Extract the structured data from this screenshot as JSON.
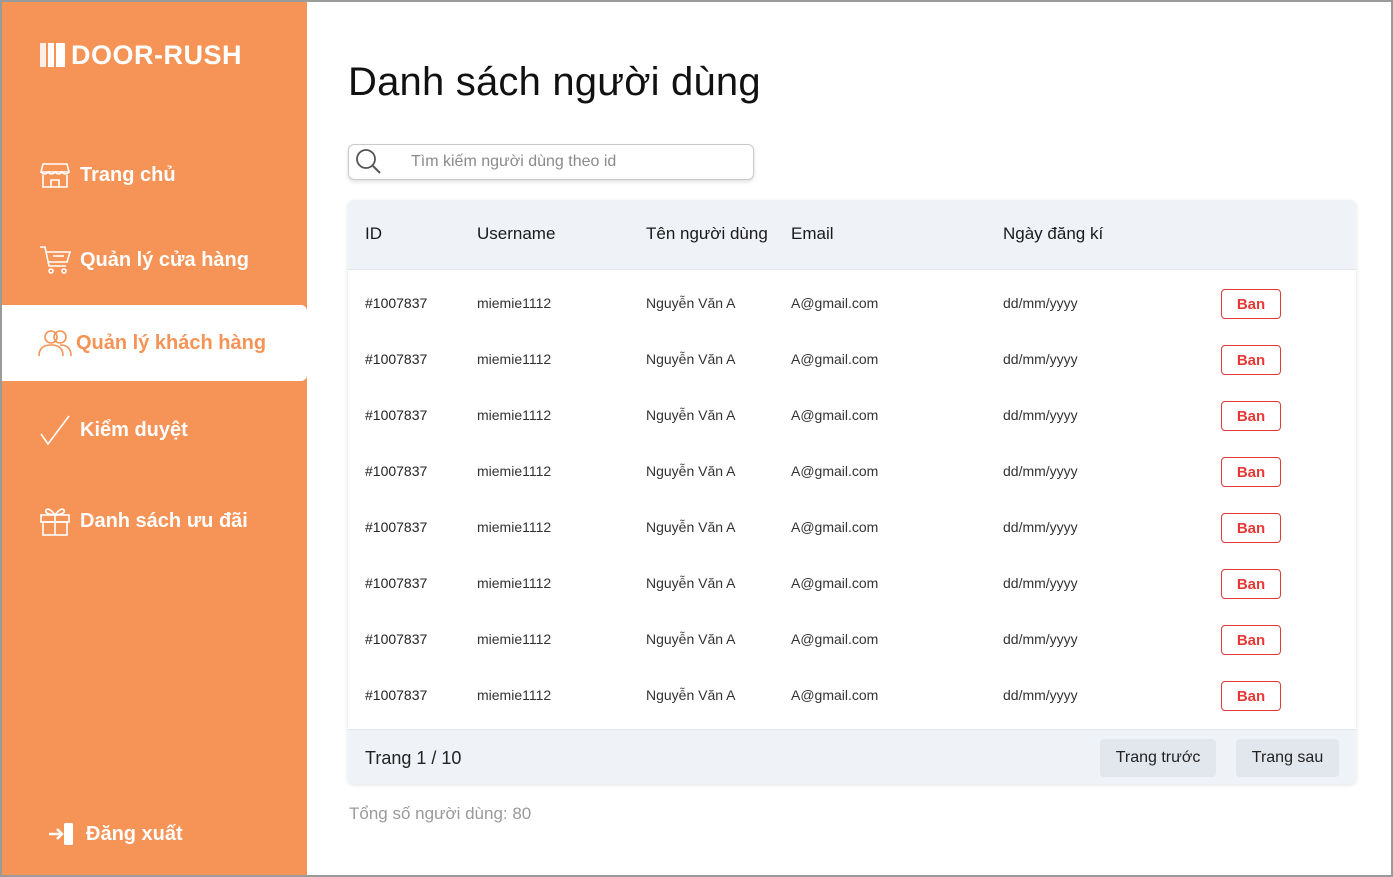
{
  "app": {
    "brand": "DOOR-RUSH"
  },
  "sidebar": {
    "items": [
      {
        "label": "Trang chủ",
        "icon": "store-icon",
        "active": false
      },
      {
        "label": "Quản lý cửa hàng",
        "icon": "cart-icon",
        "active": false
      },
      {
        "label": "Quản lý khách hàng",
        "icon": "users-icon",
        "active": true
      },
      {
        "label": "Kiểm duyệt",
        "icon": "check-icon",
        "active": false
      },
      {
        "label": "Danh sách ưu đãi",
        "icon": "gift-icon",
        "active": false
      }
    ],
    "logout_label": "Đăng xuất",
    "logout_icon": "logout-icon"
  },
  "main": {
    "title": "Danh sách người dùng",
    "search": {
      "placeholder": "Tìm kiếm người dùng theo id",
      "value": "",
      "icon": "search-icon"
    },
    "table": {
      "columns": [
        "ID",
        "Username",
        "Tên người dùng",
        "Email",
        "Ngày đăng kí"
      ],
      "action_label": "Ban",
      "rows": [
        {
          "id": "#1007837",
          "username": "miemie1112",
          "name": "Nguyễn Văn A",
          "email": "A@gmail.com",
          "date": "dd/mm/yyyy"
        },
        {
          "id": "#1007837",
          "username": "miemie1112",
          "name": "Nguyễn Văn A",
          "email": "A@gmail.com",
          "date": "dd/mm/yyyy"
        },
        {
          "id": "#1007837",
          "username": "miemie1112",
          "name": "Nguyễn Văn A",
          "email": "A@gmail.com",
          "date": "dd/mm/yyyy"
        },
        {
          "id": "#1007837",
          "username": "miemie1112",
          "name": "Nguyễn Văn A",
          "email": "A@gmail.com",
          "date": "dd/mm/yyyy"
        },
        {
          "id": "#1007837",
          "username": "miemie1112",
          "name": "Nguyễn Văn A",
          "email": "A@gmail.com",
          "date": "dd/mm/yyyy"
        },
        {
          "id": "#1007837",
          "username": "miemie1112",
          "name": "Nguyễn Văn A",
          "email": "A@gmail.com",
          "date": "dd/mm/yyyy"
        },
        {
          "id": "#1007837",
          "username": "miemie1112",
          "name": "Nguyễn Văn A",
          "email": "A@gmail.com",
          "date": "dd/mm/yyyy"
        },
        {
          "id": "#1007837",
          "username": "miemie1112",
          "name": "Nguyễn Văn A",
          "email": "A@gmail.com",
          "date": "dd/mm/yyyy"
        }
      ]
    },
    "pagination": {
      "info": "Trang 1 / 10",
      "prev_label": "Trang trước",
      "next_label": "Trang sau"
    },
    "total_label": "Tổng số người dùng: 80"
  },
  "colors": {
    "sidebar_bg": "#F69356",
    "accent": "#F69356",
    "ban": "#E53935",
    "table_header_bg": "#EFF2F7"
  }
}
